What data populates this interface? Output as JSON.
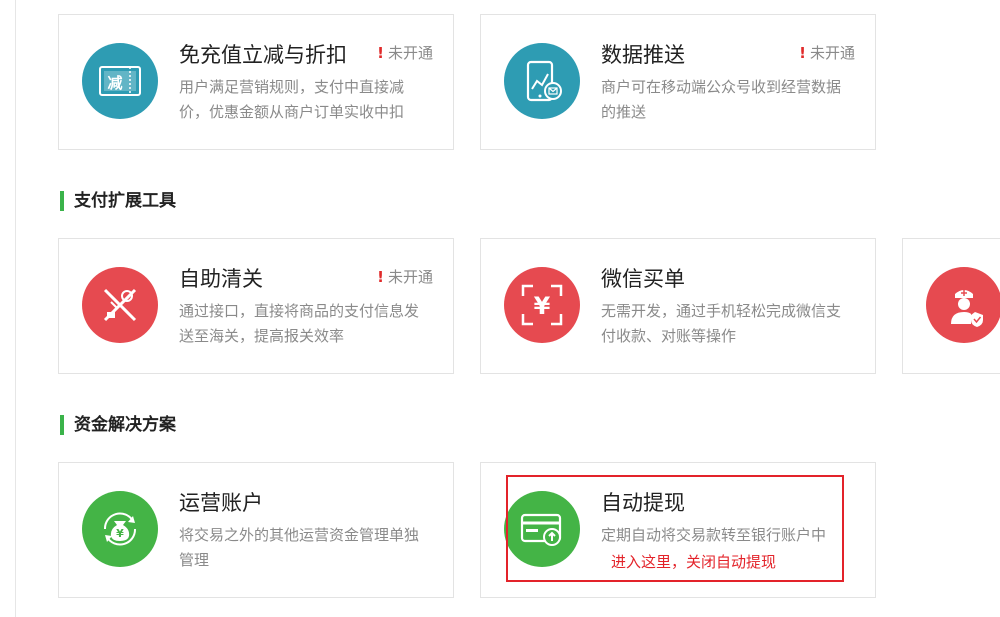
{
  "sections": [
    {
      "title": "支付扩展工具"
    },
    {
      "title": "资金解决方案"
    }
  ],
  "cards": {
    "mianchongzhi": {
      "title": "免充值立减与折扣",
      "desc": "用户满足营销规则，支付中直接减价，优惠金额从商户订单实收中扣",
      "status": "未开通",
      "icon_text": "减"
    },
    "shujutuisong": {
      "title": "数据推送",
      "desc": "商户可在移动端公众号收到经营数据的推送",
      "status": "未开通"
    },
    "zizhuqingguan": {
      "title": "自助清关",
      "desc": "通过接口，直接将商品的支付信息发送至海关，提高报关效率",
      "status": "未开通"
    },
    "weixinmaidan": {
      "title": "微信买单",
      "desc": "无需开发，通过手机轻松完成微信支付收款、对账等操作",
      "icon_text": "¥"
    },
    "yunyingzhanghu": {
      "title": "运营账户",
      "desc": "将交易之外的其他运营资金管理单独管理",
      "icon_text": "¥"
    },
    "zidongtixian": {
      "title": "自动提现",
      "desc": "定期自动将交易款转至银行账户中"
    }
  },
  "annotation": "进入这里，关闭自动提现",
  "colors": {
    "teal": "#2e9cb3",
    "red": "#e64a50",
    "green": "#44b446",
    "accent_green": "#3ab34a",
    "alert_red": "#e3232a"
  }
}
